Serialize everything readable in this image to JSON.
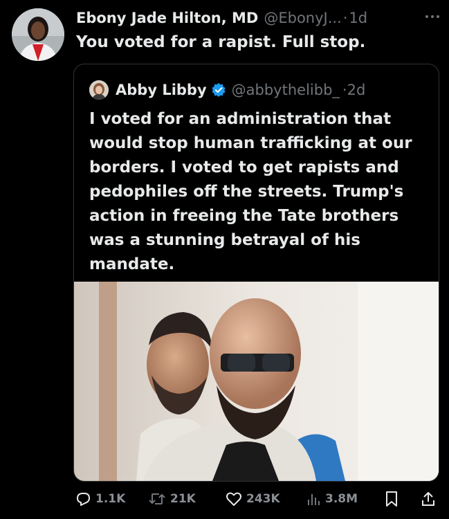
{
  "tweet": {
    "author_name": "Ebony Jade Hilton, MD",
    "author_handle": "@EbonyJ...",
    "separator": "·",
    "time": "1d",
    "text": "You voted for a rapist. Full stop."
  },
  "quoted_tweet": {
    "author_name": "Abby Libby",
    "author_handle": "@abbythelibb_",
    "separator": "·",
    "time": "2d",
    "verified": true,
    "text": "I voted for an administration that would stop human trafficking at our borders. I voted to get rapists and pedophiles off the streets. Trump's action in freeing the Tate brothers was a stunning betrayal of his mandate."
  },
  "actions": {
    "replies": "1.1K",
    "reposts": "21K",
    "likes": "243K",
    "views": "3.8M"
  },
  "colors": {
    "background": "#000000",
    "text_primary": "#e7e9ea",
    "text_secondary": "#71767b",
    "verified_blue": "#1d9bf0",
    "border": "#2f3336"
  },
  "icons": {
    "more": "more-icon",
    "verified": "verified-badge-icon",
    "reply": "reply-icon",
    "repost": "repost-icon",
    "like": "like-icon",
    "views": "views-icon",
    "bookmark": "bookmark-icon",
    "share": "share-icon"
  }
}
